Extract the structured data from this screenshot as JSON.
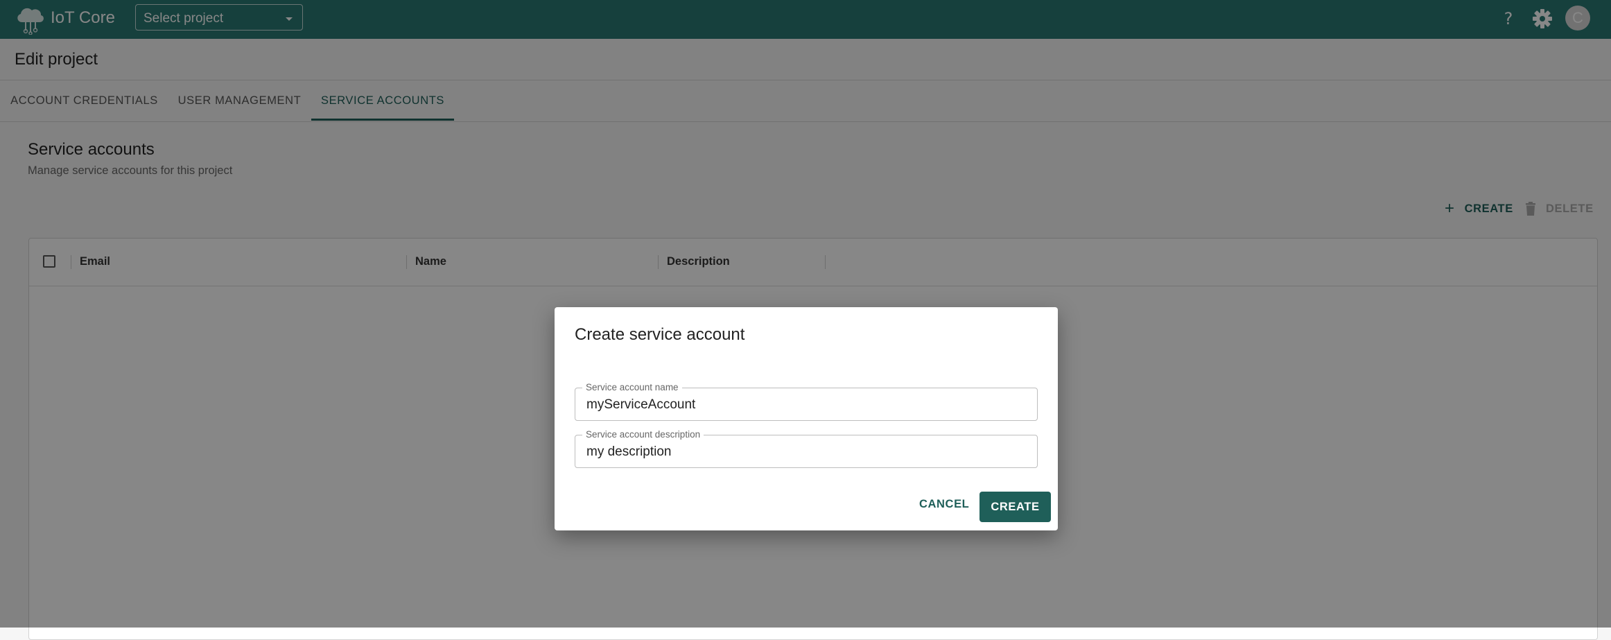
{
  "app": {
    "title": "IoT Core",
    "logo_icon": "cloud-chip-icon"
  },
  "header": {
    "project_select_value": "Select project",
    "help_icon": "question-mark-icon",
    "settings_icon": "gear-icon",
    "avatar_letter": "C"
  },
  "page": {
    "title": "Edit project"
  },
  "tabs": [
    {
      "label": "ACCOUNT CREDENTIALS",
      "active": false
    },
    {
      "label": "USER MANAGEMENT",
      "active": false
    },
    {
      "label": "SERVICE ACCOUNTS",
      "active": true
    }
  ],
  "section": {
    "title": "Service accounts",
    "subtitle": "Manage service accounts for this project"
  },
  "actions": {
    "create_label": "CREATE",
    "delete_label": "DELETE"
  },
  "table": {
    "columns": [
      "Email",
      "Name",
      "Description"
    ],
    "rows": []
  },
  "dialog": {
    "title": "Create service account",
    "name_field": {
      "label": "Service account name",
      "value": "myServiceAccount"
    },
    "description_field": {
      "label": "Service account description",
      "value": "my description"
    },
    "cancel_label": "CANCEL",
    "create_label": "CREATE"
  },
  "colors": {
    "appbar": "#2b7a74",
    "accent": "#1f5f59",
    "backdrop": "rgba(0,0,0,0.47)"
  }
}
